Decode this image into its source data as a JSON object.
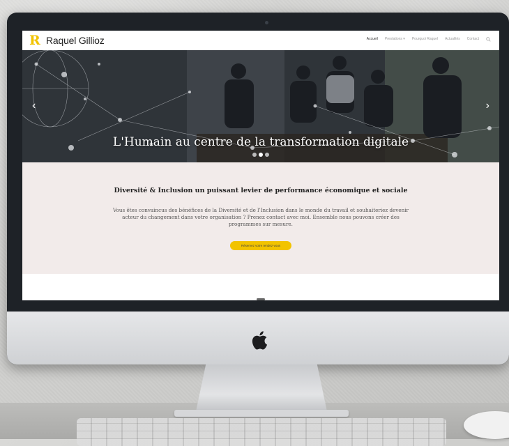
{
  "site": {
    "logo_text": "Raquel Gillioz",
    "logo_mark": "R"
  },
  "nav": {
    "items": [
      "Accueil",
      "Prestations ▾",
      "Pourquoi Raquel",
      "Actualités",
      "Contact"
    ],
    "active_index": 0
  },
  "hero": {
    "title": "L'Humain au centre de la transformation digitale",
    "slide_count": 3,
    "active_slide": 1
  },
  "intro": {
    "title": "Diversité & Inclusion un puissant levier de performance économique et sociale",
    "body": "Vous êtes convaincus des bénéfices de la Diversité et de l’Inclusion dans le monde du travail et souhaiteriez devenir acteur du changement dans votre organisation ? Prenez contact avec moi. Ensemble nous pouvons créer des programmes sur mesure.",
    "cta_label": "Réservez votre rendez-vous"
  },
  "colors": {
    "accent": "#f2c300",
    "section_bg": "#f2ebea",
    "bezel": "#1e2227"
  },
  "icons": [
    "apple-icon",
    "search-icon",
    "chevron-left-icon",
    "chevron-right-icon"
  ]
}
